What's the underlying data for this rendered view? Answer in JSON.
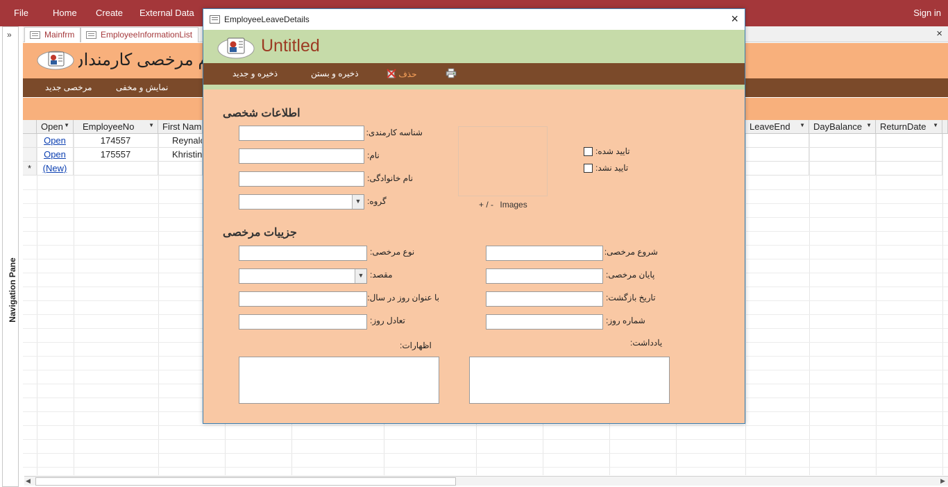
{
  "ribbon": {
    "tabs": [
      "File",
      "Home",
      "Create",
      "External Data"
    ],
    "signin": "Sign in"
  },
  "nav_pane": {
    "label": "Navigation Pane",
    "expand": "»"
  },
  "doc_tabs": [
    "Mainfrm",
    "EmployeeInformationList"
  ],
  "background_form": {
    "title": "فرم مرخصی کارمندان",
    "bar_items": [
      "مرخصی جدید",
      "نمایش و مخفی"
    ],
    "columns": [
      "Open",
      "EmployeeNo",
      "First Name",
      "LeaveEnd",
      "DayBalance",
      "ReturnDate"
    ],
    "rows": [
      {
        "open": "Open",
        "employee_no": "174557",
        "first_name": "Reynalc"
      },
      {
        "open": "Open",
        "employee_no": "175557",
        "first_name": "Khristin"
      }
    ],
    "new_row": {
      "marker": "*",
      "label": "(New)"
    }
  },
  "popup": {
    "window_title": "EmployeeLeaveDetails",
    "close": "×",
    "header_title": "Untitled",
    "toolbar": {
      "save_new": "ذخیره و جدید",
      "save_close": "ذخیره و بستن",
      "delete": "حذف",
      "print_icon": "printer-icon"
    },
    "personal": {
      "section_title": "اطلاعات شخصی",
      "employee_id_label": "شناسه کارمندی:",
      "first_name_label": "نام:",
      "last_name_label": "نام خانوادگی:",
      "group_label": "گروه:",
      "images_caption": "Images",
      "images_controls": "+ / -",
      "approved_label": "تایید شده:",
      "not_approved_label": "تایید نشد:"
    },
    "leave": {
      "section_title": "جزییات مرخصی",
      "leave_type_label": "نوع مرخصی:",
      "destination_label": "مقصد:",
      "days_per_year_label": "با عنوان روز در سال:",
      "balance_label": "تعادل روز:",
      "leave_start_label": "شروع مرخصی:",
      "leave_end_label": "پایان مرخصی:",
      "return_date_label": "تاریخ بازگشت:",
      "day_count_label": "شماره روز:",
      "notes_label": "یادداشت:",
      "remarks_label": "اظهارات:"
    }
  },
  "colors": {
    "ribbon": "#a4373a",
    "form_orange": "#f8b07c",
    "popup_body": "#f9c8a4",
    "popup_header": "#c6dba9",
    "toolbar_brown": "#7b4a2a",
    "title_red": "#9c3b23",
    "delete_orange": "#f7a15a",
    "link_blue": "#0b3fb1"
  }
}
